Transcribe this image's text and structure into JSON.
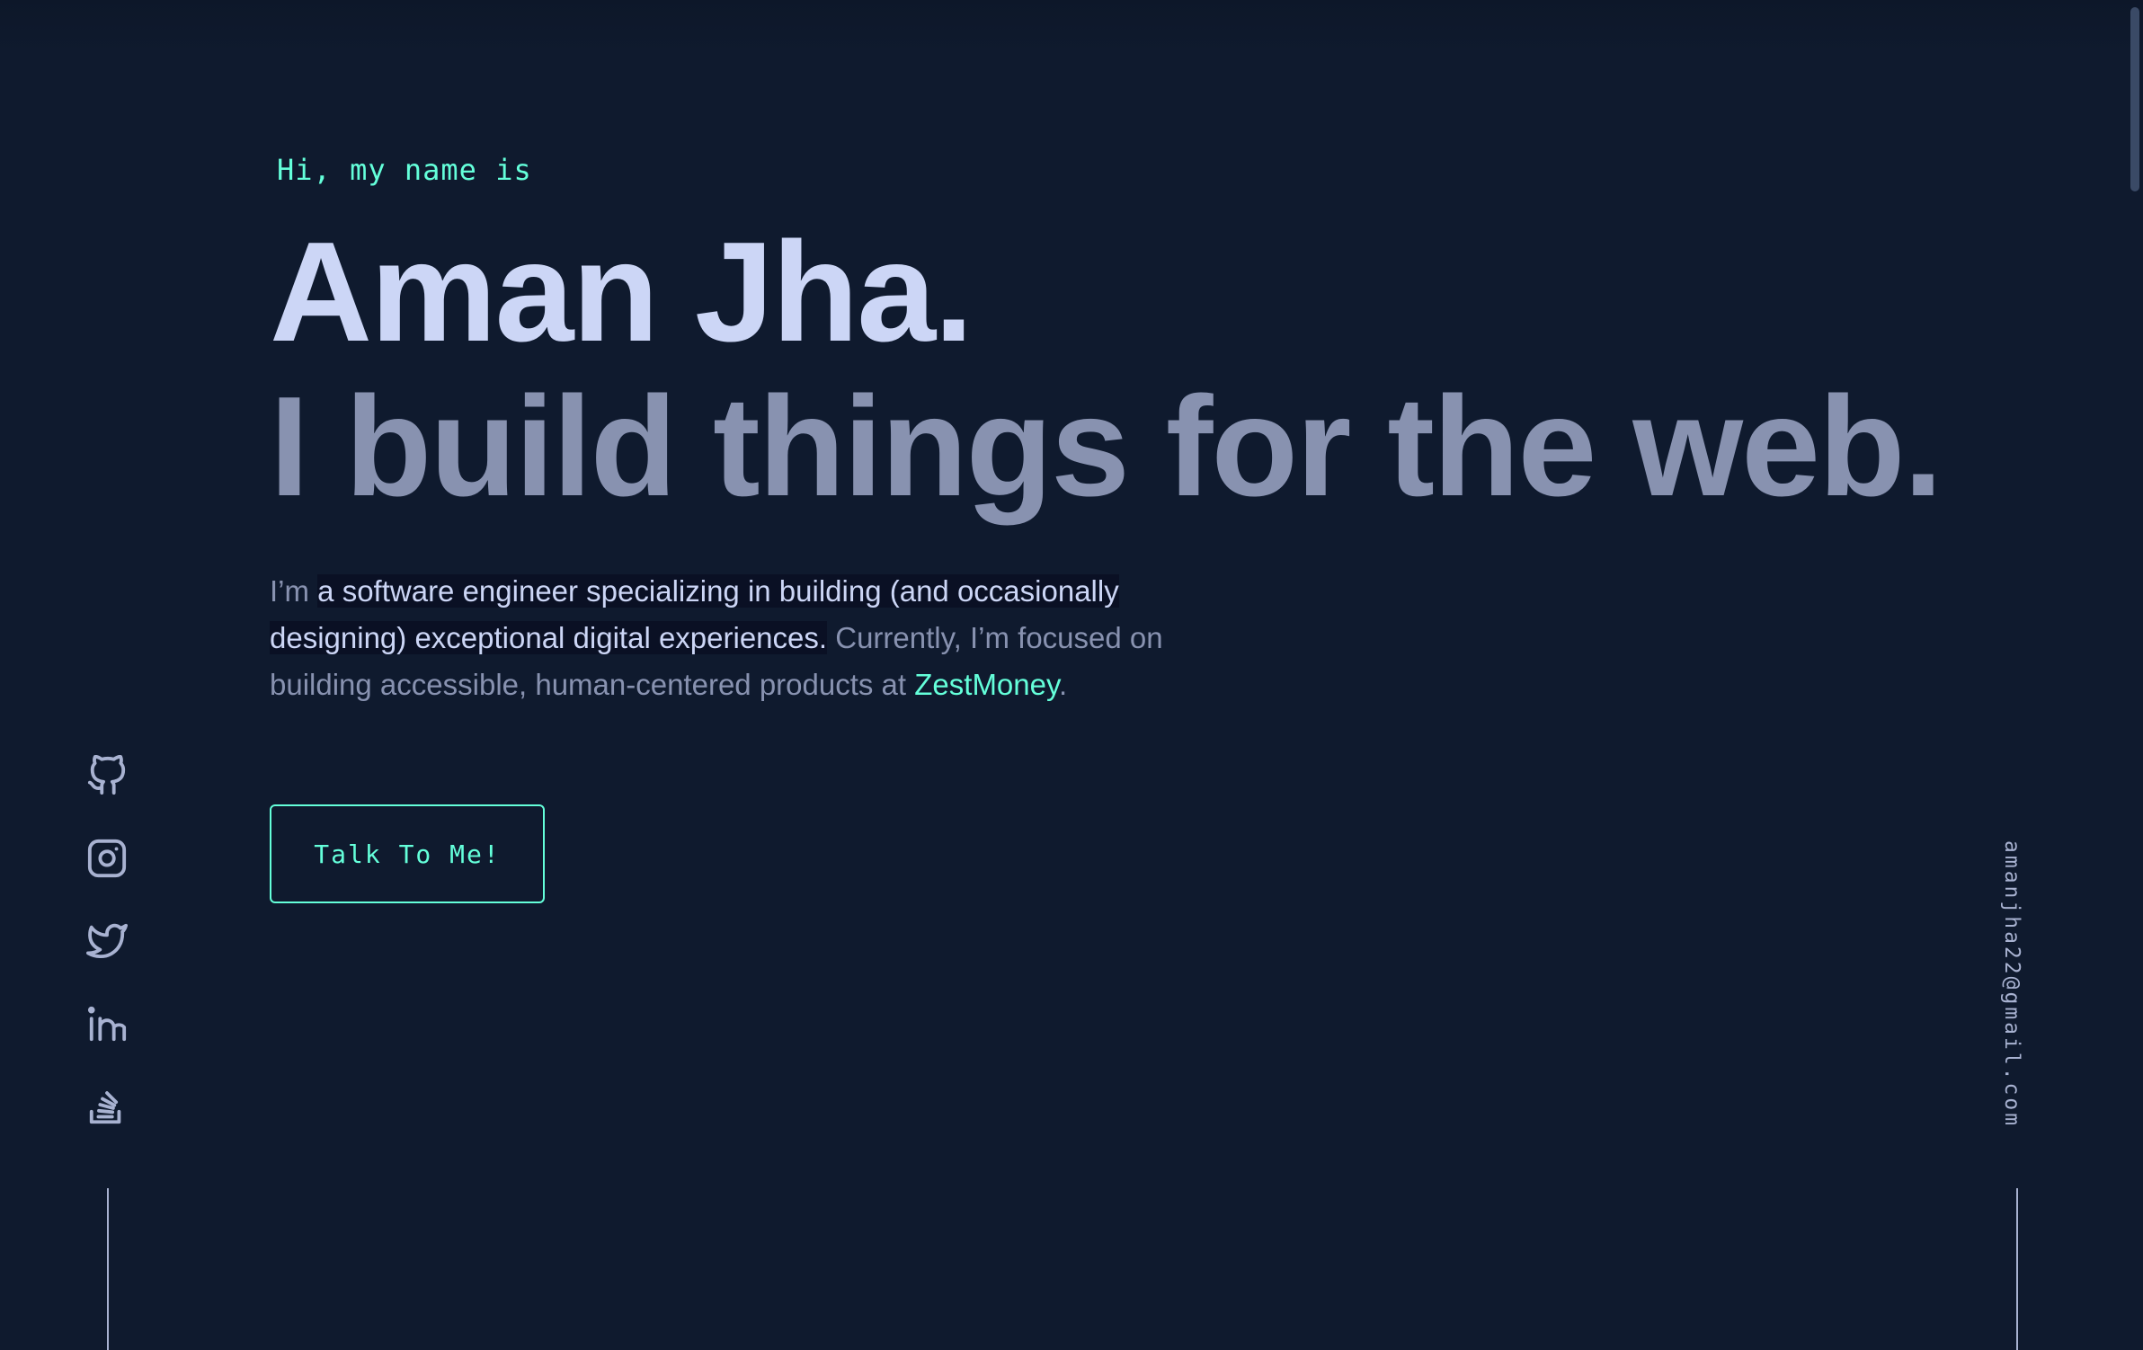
{
  "hero": {
    "greeting": "Hi, my name is",
    "name": "Aman Jha.",
    "tagline": "I build things for the web.",
    "intro": {
      "part1": "I’m ",
      "highlight": "a software engineer specializing in building (and occasionally designing) exceptional digital experiences.",
      "part2": " Currently, I’m focused on building accessible, human-centered products at ",
      "company": "ZestMoney",
      "part3": "."
    },
    "cta_label": "Talk To Me!"
  },
  "social": {
    "items": [
      {
        "icon": "github-icon"
      },
      {
        "icon": "instagram-icon"
      },
      {
        "icon": "twitter-icon"
      },
      {
        "icon": "linkedin-icon"
      },
      {
        "icon": "stackoverflow-icon"
      }
    ]
  },
  "email": "amanjha22@gmail.com",
  "colors": {
    "background": "#0f1a2e",
    "accent": "#64ffda",
    "heading": "#ccd6f6",
    "muted": "#8892b0",
    "icon": "#a8b2d1"
  }
}
